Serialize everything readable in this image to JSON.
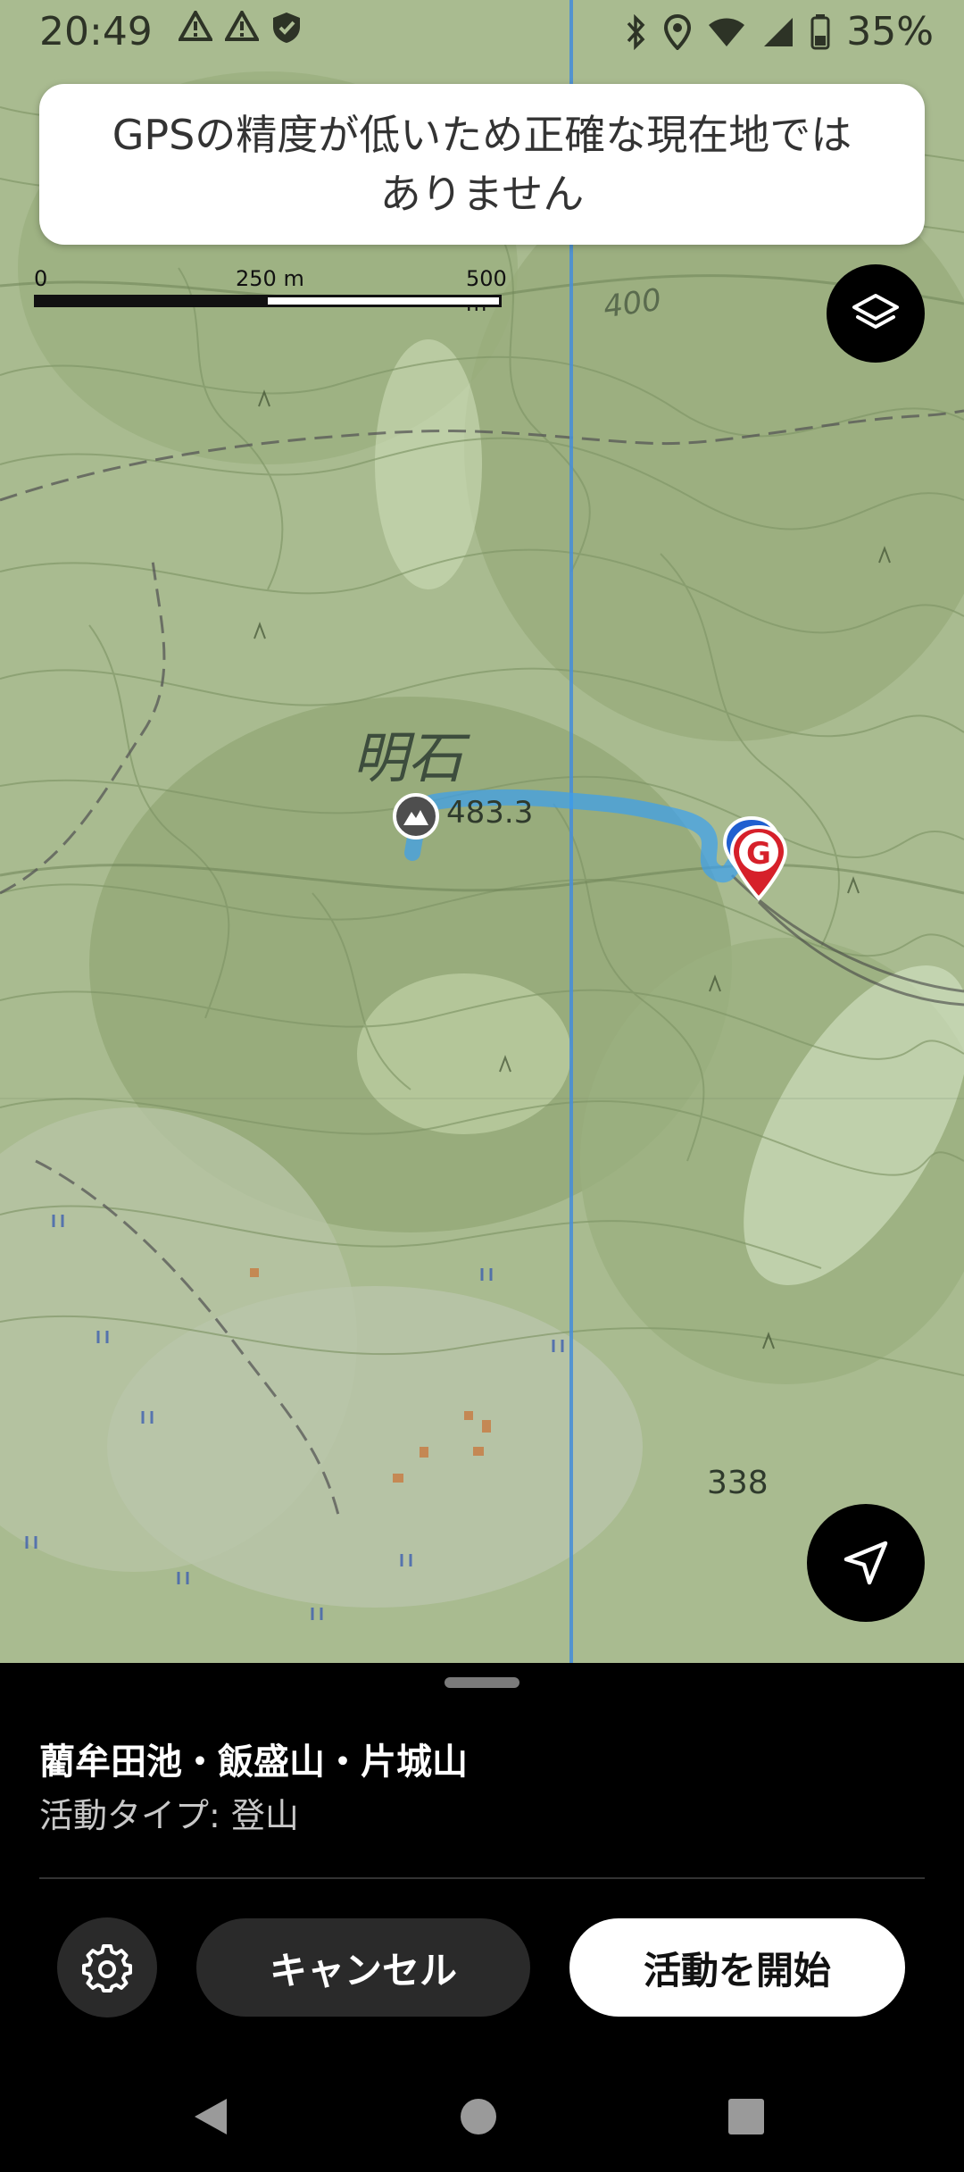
{
  "status_bar": {
    "time": "20:49",
    "battery": "35%",
    "icons_left": [
      "alert-triangle-icon",
      "alert-triangle-icon",
      "shield-icon"
    ],
    "icons_right": [
      "bluetooth-icon",
      "location-icon",
      "wifi-icon",
      "signal-icon",
      "battery-icon"
    ]
  },
  "toast": {
    "message_line1": "GPSの精度が低いため正確な現在地では",
    "message_line2": "ありません"
  },
  "scale": {
    "label_0": "0",
    "label_mid": "250 m",
    "label_max": "500 m"
  },
  "map": {
    "place_name": "明石",
    "elevation_1": "483.3",
    "elevation_2": "338",
    "contour_label": "400",
    "start_marker": "mountain-icon",
    "goal_marker_letter": "G"
  },
  "buttons": {
    "layers": "layers-icon",
    "locate": "navigation-arrow-icon"
  },
  "sheet": {
    "route_title": "藺牟田池・飯盛山・片城山",
    "activity_type": "活動タイプ: 登山",
    "cancel_label": "キャンセル",
    "start_label": "活動を開始",
    "settings_icon": "gear-icon"
  },
  "navbar": {
    "back": "back-icon",
    "home": "home-icon",
    "recents": "recents-icon"
  }
}
